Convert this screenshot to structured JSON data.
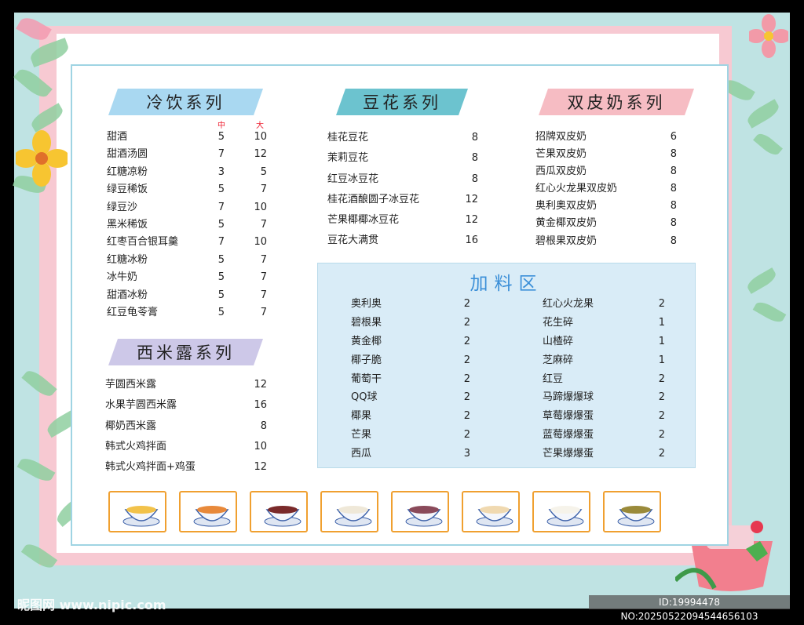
{
  "cold_drinks": {
    "title": "冷饮系列",
    "size_medium": "中",
    "size_large": "大",
    "items": [
      {
        "name": "甜酒",
        "medium": "5",
        "large": "10"
      },
      {
        "name": "甜酒汤圆",
        "medium": "7",
        "large": "12"
      },
      {
        "name": "红糖凉粉",
        "medium": "3",
        "large": "5"
      },
      {
        "name": "绿豆稀饭",
        "medium": "5",
        "large": "7"
      },
      {
        "name": "绿豆沙",
        "medium": "7",
        "large": "10"
      },
      {
        "name": "黑米稀饭",
        "medium": "5",
        "large": "7"
      },
      {
        "name": "红枣百合银耳羹",
        "medium": "7",
        "large": "10"
      },
      {
        "name": "红糖冰粉",
        "medium": "5",
        "large": "7"
      },
      {
        "name": "冰牛奶",
        "medium": "5",
        "large": "7"
      },
      {
        "name": "甜酒冰粉",
        "medium": "5",
        "large": "7"
      },
      {
        "name": "红豆龟苓膏",
        "medium": "5",
        "large": "7"
      }
    ]
  },
  "sago": {
    "title": "西米露系列",
    "items": [
      {
        "name": "芋圆西米露",
        "price": "12"
      },
      {
        "name": "水果芋圆西米露",
        "price": "16"
      },
      {
        "name": "椰奶西米露",
        "price": "8"
      },
      {
        "name": "韩式火鸡拌面",
        "price": "10"
      },
      {
        "name": "韩式火鸡拌面+鸡蛋",
        "price": "12"
      }
    ]
  },
  "tofu_pudding": {
    "title": "豆花系列",
    "items": [
      {
        "name": "桂花豆花",
        "price": "8"
      },
      {
        "name": "茉莉豆花",
        "price": "8"
      },
      {
        "name": "红豆冰豆花",
        "price": "8"
      },
      {
        "name": "桂花酒酿圆子冰豆花",
        "price": "12"
      },
      {
        "name": "芒果椰椰冰豆花",
        "price": "12"
      },
      {
        "name": "豆花大满贯",
        "price": "16"
      }
    ]
  },
  "double_milk": {
    "title": "双皮奶系列",
    "items": [
      {
        "name": "招牌双皮奶",
        "price": "6"
      },
      {
        "name": "芒果双皮奶",
        "price": "8"
      },
      {
        "name": "西瓜双皮奶",
        "price": "8"
      },
      {
        "name": "红心火龙果双皮奶",
        "price": "8"
      },
      {
        "name": "奥利奥双皮奶",
        "price": "8"
      },
      {
        "name": "黄金椰双皮奶",
        "price": "8"
      },
      {
        "name": "碧根果双皮奶",
        "price": "8"
      }
    ]
  },
  "extras": {
    "title": "加料区",
    "left": [
      {
        "name": "奥利奥",
        "price": "2"
      },
      {
        "name": "碧根果",
        "price": "2"
      },
      {
        "name": "黄金椰",
        "price": "2"
      },
      {
        "name": "椰子脆",
        "price": "2"
      },
      {
        "name": "葡萄干",
        "price": "2"
      },
      {
        "name": "QQ球",
        "price": "2"
      },
      {
        "name": "椰果",
        "price": "2"
      },
      {
        "name": "芒果",
        "price": "2"
      },
      {
        "name": "西瓜",
        "price": "3"
      }
    ],
    "right": [
      {
        "name": "红心火龙果",
        "price": "2"
      },
      {
        "name": "花生碎",
        "price": "1"
      },
      {
        "name": "山楂碎",
        "price": "1"
      },
      {
        "name": "芝麻碎",
        "price": "1"
      },
      {
        "name": "红豆",
        "price": "2"
      },
      {
        "name": "马蹄爆爆球",
        "price": "2"
      },
      {
        "name": "草莓爆爆蛋",
        "price": "2"
      },
      {
        "name": "蓝莓爆爆蛋",
        "price": "2"
      },
      {
        "name": "芒果爆爆蛋",
        "price": "2"
      }
    ]
  },
  "thumbnails": [
    {
      "icon": "dessert-bowl-icon",
      "color": "#f2c24a"
    },
    {
      "icon": "dessert-bowl-icon",
      "color": "#e8893a"
    },
    {
      "icon": "dessert-bowl-icon",
      "color": "#7a2a2a"
    },
    {
      "icon": "dessert-bowl-icon",
      "color": "#efe8d8"
    },
    {
      "icon": "dessert-bowl-icon",
      "color": "#8a4a5a"
    },
    {
      "icon": "dessert-bowl-icon",
      "color": "#f0d9b0"
    },
    {
      "icon": "dessert-bowl-icon",
      "color": "#f6f3ea"
    },
    {
      "icon": "dessert-bowl-icon",
      "color": "#9a8a3a"
    }
  ],
  "watermark": {
    "site": "昵图网 www.nipic.com",
    "id": "ID:19994478 NO:20250522094544656103"
  },
  "colors": {
    "background": "#bfe3e3",
    "frame_pink": "#f7c9d2",
    "extras_bg": "#d9ecf7",
    "extras_title": "#3b8fd8",
    "thumb_border": "#f0a030"
  }
}
